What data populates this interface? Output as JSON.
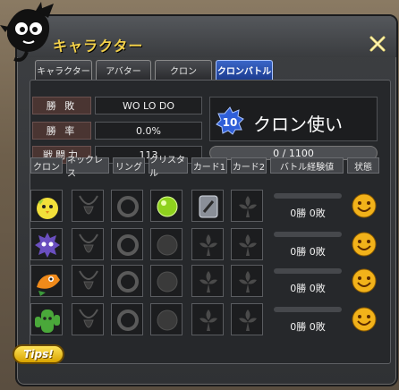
{
  "window": {
    "title": "キャラクター"
  },
  "tabs": [
    {
      "label": "キャラクター",
      "active": false
    },
    {
      "label": "アバター",
      "active": false
    },
    {
      "label": "クロン",
      "active": false
    },
    {
      "label": "クロンバトル",
      "active": true
    }
  ],
  "stats": [
    {
      "label": "勝 敗",
      "value": "WO LO DO"
    },
    {
      "label": "勝 率",
      "value": "0.0%"
    },
    {
      "label": "戦闘力",
      "value": "113"
    }
  ],
  "clone": {
    "level": "10",
    "name": "クロン使い",
    "exp_text": "0 / 1100",
    "exp_progress": 0.0
  },
  "columns": [
    "クロン",
    "ネックレス",
    "リング",
    "クリスタル",
    "カード1",
    "カード2",
    "バトル経験値",
    "状態"
  ],
  "rows": [
    {
      "clone_icon": "yellow-chick-icon",
      "crystal": "green-crystal-icon",
      "card1": "silver-card-icon",
      "record": "0勝 0敗"
    },
    {
      "clone_icon": "purple-spiky-icon",
      "crystal": "empty",
      "card1": "empty",
      "record": "0勝 0敗"
    },
    {
      "clone_icon": "orange-bird-icon",
      "crystal": "empty",
      "card1": "empty",
      "record": "0勝 0敗"
    },
    {
      "clone_icon": "green-cactus-icon",
      "crystal": "empty",
      "card1": "empty",
      "record": "0勝 0敗"
    }
  ],
  "tips": {
    "label": "Tips!"
  },
  "colors": {
    "accent": "#f2d04a",
    "tab_active": "#2a55b8",
    "stat_label_bg": "#4a3532"
  }
}
